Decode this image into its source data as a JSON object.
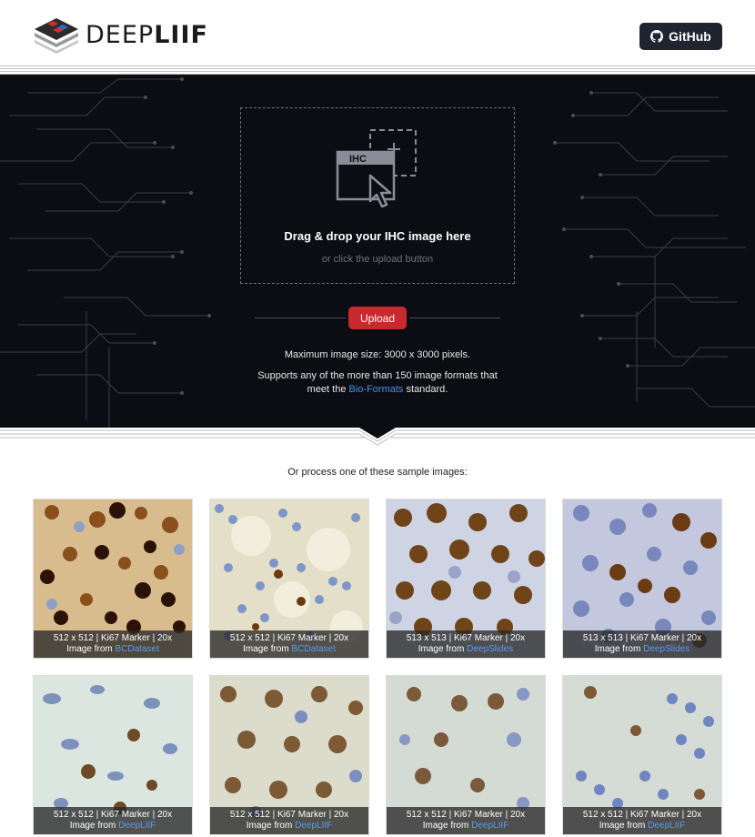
{
  "header": {
    "logo_text_light": "DEEP",
    "logo_text_bold": "LIIF",
    "github_label": "GitHub"
  },
  "dropzone": {
    "icon_label": "IHC",
    "title": "Drag & drop your IHC image here",
    "subtitle": "or click the upload button"
  },
  "upload_label": "Upload",
  "info": {
    "max_size": "Maximum image size: 3000 x 3000 pixels.",
    "formats_line1": "Supports any of the more than 150 image formats that",
    "formats_pre": "meet the ",
    "formats_link": "Bio-Formats",
    "formats_post": " standard."
  },
  "samples": {
    "title": "Or process one of these sample images:",
    "items": [
      {
        "spec": "512 x 512  |  Ki67 Marker  |  20x",
        "from": "Image from ",
        "source": "BCDataset"
      },
      {
        "spec": "512 x 512  |  Ki67 Marker  |  20x",
        "from": "Image from ",
        "source": "BCDataset"
      },
      {
        "spec": "513 x 513  |  Ki67 Marker  |  20x",
        "from": "Image from ",
        "source": "DeepSlides"
      },
      {
        "spec": "513 x 513  |  Ki67 Marker  |  20x",
        "from": "Image from ",
        "source": "DeepSlides"
      },
      {
        "spec": "512 x 512  |  Ki67 Marker  |  20x",
        "from": "Image from ",
        "source": "DeepLIIF"
      },
      {
        "spec": "512 x 512  |  Ki67 Marker  |  20x",
        "from": "Image from ",
        "source": "DeepLIIF"
      },
      {
        "spec": "512 x 512  |  Ki67 Marker  |  20x",
        "from": "Image from ",
        "source": "DeepLIIF"
      },
      {
        "spec": "512 x 512  |  Ki67 Marker  |  20x",
        "from": "Image from ",
        "source": "DeepLIIF"
      }
    ]
  },
  "colors": {
    "hero_bg": "#0c0d12",
    "upload_button": "#c8292c",
    "link_blue": "#4d8ef0",
    "github_bg": "#1f2430"
  }
}
